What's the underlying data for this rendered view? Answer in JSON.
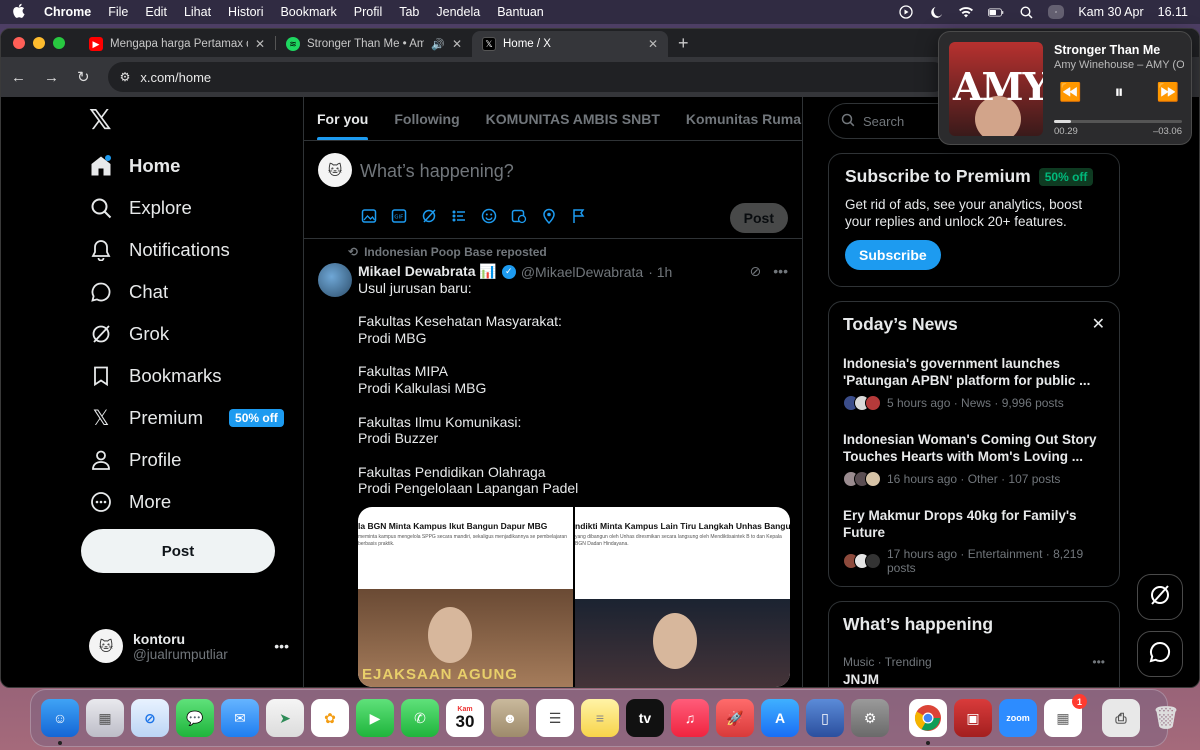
{
  "menubar": {
    "app_name": "Chrome",
    "menus": [
      "File",
      "Edit",
      "Lihat",
      "Histori",
      "Bookmark",
      "Profil",
      "Tab",
      "Jendela",
      "Bantuan"
    ],
    "date": "Kam 30 Apr",
    "time": "16.11"
  },
  "browser": {
    "tabs": [
      {
        "title": "Mengapa harga Pertamax dan",
        "favicon": "youtube-icon"
      },
      {
        "title": "Stronger Than Me • Amy W",
        "favicon": "spotify-icon"
      },
      {
        "title": "Home / X",
        "favicon": "x-icon"
      }
    ],
    "url": "x.com/home"
  },
  "now_playing": {
    "title": "Stronger Than Me",
    "artist": "Amy Winehouse – AMY (O",
    "album_text": "AMY",
    "elapsed": "00.29",
    "remaining": "–03.06",
    "progress": 0.13
  },
  "nav": {
    "items": [
      {
        "label": "Home",
        "icon": "home-icon"
      },
      {
        "label": "Explore",
        "icon": "search-icon"
      },
      {
        "label": "Notifications",
        "icon": "bell-icon"
      },
      {
        "label": "Chat",
        "icon": "chat-icon"
      },
      {
        "label": "Grok",
        "icon": "grok-icon"
      },
      {
        "label": "Bookmarks",
        "icon": "bookmark-icon"
      },
      {
        "label": "Premium",
        "icon": "x-icon"
      },
      {
        "label": "Profile",
        "icon": "person-icon"
      },
      {
        "label": "More",
        "icon": "more-circle-icon"
      }
    ],
    "premium_badge": "50% off",
    "post_label": "Post"
  },
  "account": {
    "name": "kontoru",
    "handle": "@jualrumputliar"
  },
  "feed": {
    "tabs": [
      "For you",
      "Following",
      "KOMUNITAS AMBIS SNBT",
      "Komunitas Rumah-Rumah"
    ],
    "composer_placeholder": "What’s happening?",
    "composer_post": "Post"
  },
  "tweet": {
    "repost_by": "Indonesian Poop Base reposted",
    "name": "Mikael Dewabrata 📊",
    "handle": "@MikaelDewabrata",
    "time": "· 1h",
    "lines": [
      "Usul jurusan baru:",
      "",
      "Fakultas Kesehatan Masyarakat:",
      "Prodi MBG",
      "",
      "Fakultas MIPA",
      "Prodi Kalkulasi MBG",
      "",
      "Fakultas Ilmu Komunikasi:",
      "Prodi Buzzer",
      "",
      "Fakultas Pendidikan Olahraga",
      "Prodi Pengelolaan Lapangan Padel"
    ],
    "media": [
      {
        "headline": "la BGN Minta Kampus Ikut Bangun Dapur MBG",
        "sub": "meminta kampus mengelola SPPG secara mandiri, sekaligus menjadikannya se pembelajaran berbasis praktik.",
        "sign": "EJAKSAAN AGUNG"
      },
      {
        "headline": "ndikti Minta Kampus Lain Tiru Langkah Unhas Bangun Da",
        "sub": "yang dibangun oleh Unhas diresmikan secara langsung oleh Mendiktisaintek B to dan Kepala BGN Dadan Hindayana."
      }
    ]
  },
  "sidebar": {
    "search_placeholder": "Search",
    "premium": {
      "title": "Subscribe to Premium",
      "badge": "50% off",
      "desc": "Get rid of ads, see your analytics, boost your replies and unlock 20+ features.",
      "button": "Subscribe"
    },
    "news": {
      "title": "Today’s News",
      "items": [
        {
          "headline": "Indonesia's government launches 'Patungan APBN' platform for public ...",
          "meta": "5 hours ago · News · 9,996 posts"
        },
        {
          "headline": "Indonesian Woman's Coming Out Story Touches Hearts with Mom's Loving ...",
          "meta": "16 hours ago · Other · 107 posts"
        },
        {
          "headline": "Ery Makmur Drops 40kg for Family's Future",
          "meta": "17 hours ago · Entertainment · 8,219 posts"
        }
      ]
    },
    "happening": {
      "title": "What’s happening",
      "trend_meta": "Music · Trending",
      "trend_name": "JNJM"
    }
  },
  "dock": {
    "calendar_month": "Kam",
    "calendar_day": "30",
    "appstore_badge": "1",
    "zoom_label": "zoom"
  }
}
